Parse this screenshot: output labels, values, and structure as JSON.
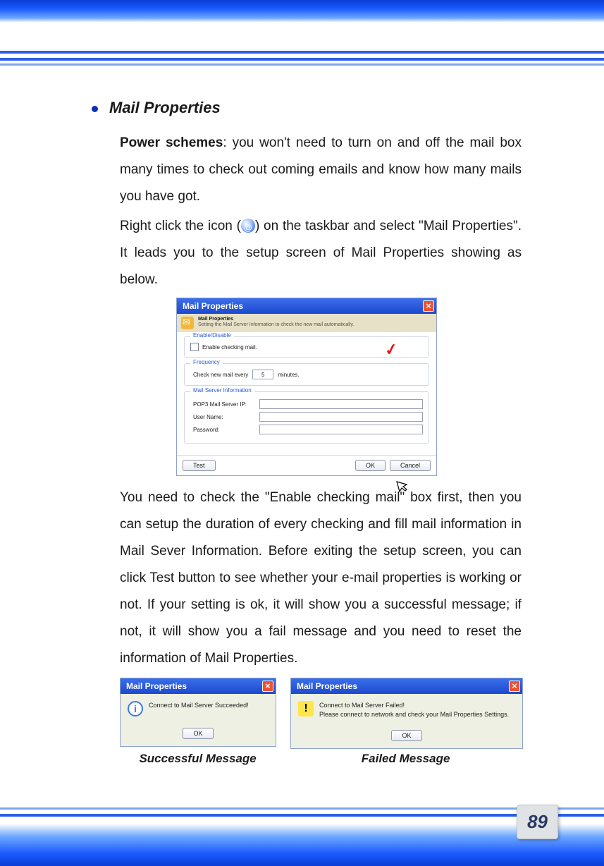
{
  "page_number": "89",
  "section": {
    "heading": "Mail Properties",
    "para1_bold": "Power schemes",
    "para1_rest": ": you won't need to turn on and off the mail box many times to check out coming emails and know how many mails you have got.",
    "para2_pre": "Right click the icon (",
    "para2_post": ") on the taskbar and select \"Mail Properties\". It leads you to the setup screen of Mail Properties showing as below.",
    "para3": "You need to check the \"Enable checking mail\" box first, then you can setup the duration of every checking and fill mail information in Mail Sever Information.  Before exiting the setup screen, you can click Test button to see whether your e-mail properties is working or not. If your setting is ok, it will show you a successful message; if not, it will show you a fail message and you need to reset the information of Mail Properties."
  },
  "dialog": {
    "title": "Mail Properties",
    "info_t1": "Mail Properties",
    "info_t2": "Setting the Mail Server Information to check the new mail automatically.",
    "fs_enable": "Enable/Disable",
    "enable_label": "Enable checking mail.",
    "fs_freq": "Frequency",
    "freq_pre": "Check new mail every",
    "freq_value": "5",
    "freq_post": "minutes.",
    "fs_server": "Mail Server Information",
    "lbl_pop3": "POP3 Mail Server IP:",
    "lbl_user": "User Name:",
    "lbl_pass": "Password:",
    "btn_test": "Test",
    "btn_ok": "OK",
    "btn_cancel": "Cancel"
  },
  "msg_success": {
    "title": "Mail Properties",
    "text": "Connect to Mail Server Succeeded!",
    "ok": "OK",
    "caption": "Successful Message"
  },
  "msg_fail": {
    "title": "Mail Properties",
    "line1": "Connect to Mail Server Failed!",
    "line2": "Please connect to network and check your Mail Properties Settings.",
    "ok": "OK",
    "caption": "Failed Message"
  }
}
